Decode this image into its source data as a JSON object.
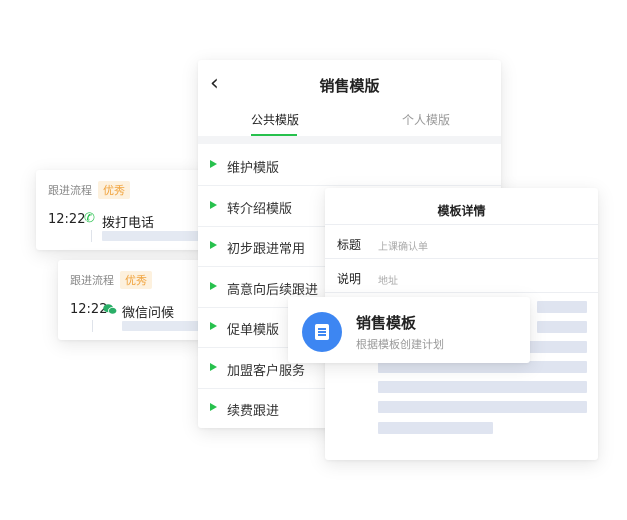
{
  "follow_cards": [
    {
      "header": "跟进流程",
      "badge": "优秀",
      "time": "12:22",
      "icon": "phone-icon",
      "action": "拨打电话"
    },
    {
      "header": "跟进流程",
      "badge": "优秀",
      "time": "12:22",
      "icon": "wechat-icon",
      "action": "微信问候"
    }
  ],
  "templates_panel": {
    "back_icon": "chevron-left-icon",
    "title": "销售模版",
    "tabs": [
      {
        "label": "公共模版",
        "active": true
      },
      {
        "label": "个人模版",
        "active": false
      }
    ],
    "items": [
      "维护模版",
      "转介绍模版",
      "初步跟进常用",
      "高意向后续跟进",
      "促单模版",
      "加盟客户服务",
      "续费跟进"
    ]
  },
  "detail_panel": {
    "title": "模板详情",
    "fields": [
      {
        "label": "标题",
        "placeholder": "上课确认单"
      },
      {
        "label": "说明",
        "placeholder": "地址"
      }
    ]
  },
  "popup": {
    "icon": "document-icon",
    "title": "销售模板",
    "subtitle": "根据模板创建计划"
  },
  "colors": {
    "accent_green": "#27c14d",
    "badge_orange": "#f0a23b",
    "icon_blue": "#3d86f2",
    "wechat_green": "#2aae67"
  }
}
